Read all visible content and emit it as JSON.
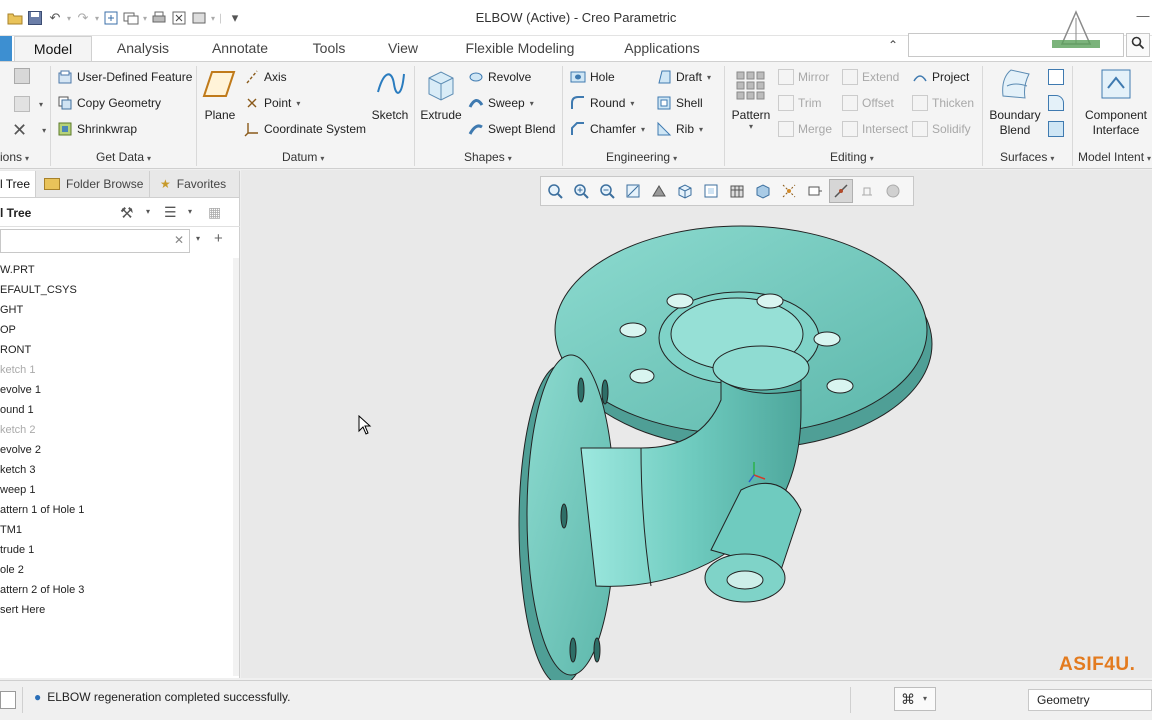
{
  "window": {
    "title": "ELBOW (Active) - Creo Parametric"
  },
  "tabs": [
    {
      "label": "Model",
      "active": true
    },
    {
      "label": "Analysis"
    },
    {
      "label": "Annotate"
    },
    {
      "label": "Tools"
    },
    {
      "label": "View"
    },
    {
      "label": "Flexible Modeling"
    },
    {
      "label": "Applications"
    }
  ],
  "ribbon": {
    "operations": {
      "label": "ions"
    },
    "get_data": {
      "label": "Get Data",
      "items": [
        "User-Defined Feature",
        "Copy Geometry",
        "Shrinkwrap"
      ]
    },
    "datum": {
      "label": "Datum",
      "plane": "Plane",
      "axis": "Axis",
      "point": "Point",
      "csys": "Coordinate System",
      "sketch": "Sketch"
    },
    "shapes": {
      "label": "Shapes",
      "extrude": "Extrude",
      "revolve": "Revolve",
      "sweep": "Sweep",
      "swept_blend": "Swept Blend"
    },
    "engineering": {
      "label": "Engineering",
      "hole": "Hole",
      "round": "Round",
      "chamfer": "Chamfer",
      "draft": "Draft",
      "shell": "Shell",
      "rib": "Rib"
    },
    "editing": {
      "label": "Editing",
      "pattern": "Pattern",
      "mirror": "Mirror",
      "trim": "Trim",
      "merge": "Merge",
      "extend": "Extend",
      "offset": "Offset",
      "intersect": "Intersect",
      "project": "Project",
      "thicken": "Thicken",
      "solidify": "Solidify"
    },
    "surfaces": {
      "label": "Surfaces",
      "boundary_blend": "Boundary Blend"
    },
    "model_intent": {
      "label": "Model Intent",
      "component_interface": "Component Interface"
    }
  },
  "panel": {
    "tabs": [
      "l Tree",
      "Folder Browse",
      "Favorites"
    ],
    "title": "l Tree",
    "tree": [
      {
        "label": "W.PRT"
      },
      {
        "label": "EFAULT_CSYS"
      },
      {
        "label": "GHT"
      },
      {
        "label": "OP"
      },
      {
        "label": "RONT"
      },
      {
        "label": "ketch 1",
        "dim": true
      },
      {
        "label": "evolve 1"
      },
      {
        "label": "ound 1"
      },
      {
        "label": "ketch 2",
        "dim": true
      },
      {
        "label": "evolve 2"
      },
      {
        "label": "ketch 3"
      },
      {
        "label": "weep 1"
      },
      {
        "label": "attern 1 of Hole 1"
      },
      {
        "label": "TM1"
      },
      {
        "label": "trude 1"
      },
      {
        "label": "ole 2"
      },
      {
        "label": "attern 2 of Hole 3"
      },
      {
        "label": "sert Here"
      }
    ]
  },
  "graphics": {
    "watermark": "ASIF4U.",
    "model_color": "#6ccbbd"
  },
  "status": {
    "message": "ELBOW regeneration completed successfully.",
    "filter": "Geometry"
  },
  "colors": {
    "accent": "#3d8fd1",
    "watermark": "#e37b1f"
  }
}
